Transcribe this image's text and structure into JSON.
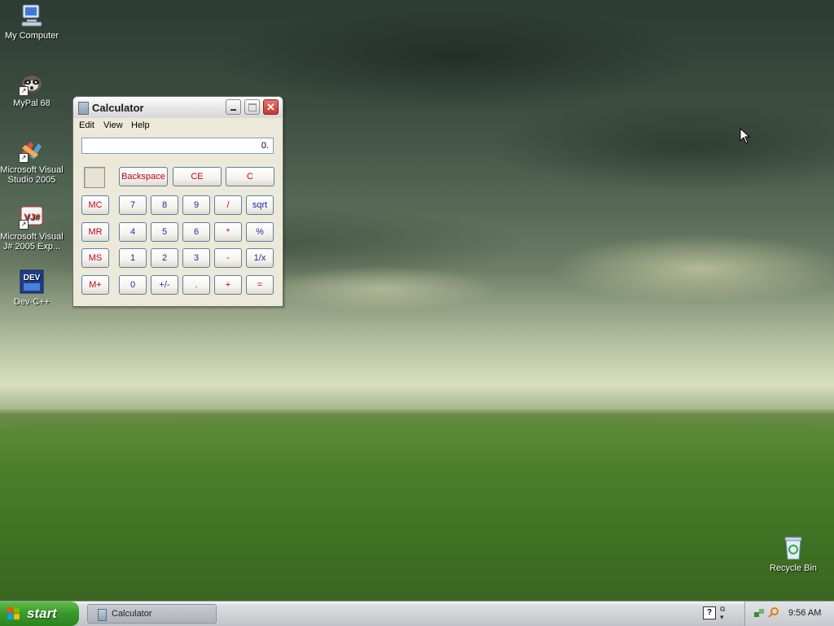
{
  "desktop": {
    "icons": [
      {
        "label": "My Computer"
      },
      {
        "label": "MyPal 68"
      },
      {
        "label": "Microsoft Visual Studio 2005"
      },
      {
        "label": "Microsoft Visual J# 2005 Exp..."
      },
      {
        "label": "Dev-C++"
      },
      {
        "label": "Recycle Bin"
      }
    ]
  },
  "calculator": {
    "title": "Calculator",
    "menu": [
      "Edit",
      "View",
      "Help"
    ],
    "display": "0.",
    "buttons": {
      "backspace": "Backspace",
      "ce": "CE",
      "c": "C",
      "mc": "MC",
      "mr": "MR",
      "ms": "MS",
      "mplus": "M+",
      "d7": "7",
      "d8": "8",
      "d9": "9",
      "div": "/",
      "sqrt": "sqrt",
      "d4": "4",
      "d5": "5",
      "d6": "6",
      "mul": "*",
      "pct": "%",
      "d1": "1",
      "d2": "2",
      "d3": "3",
      "sub": "-",
      "recip": "1/x",
      "d0": "0",
      "sign": "+/-",
      "dot": ".",
      "add": "+",
      "eq": "="
    }
  },
  "taskbar": {
    "start_label": "start",
    "tasks": [
      {
        "label": "Calculator"
      }
    ],
    "clock": "9:56 AM",
    "help_glyph": "?"
  },
  "colors": {
    "start_green": "#3a9b2b",
    "calc_red": "#c0001c",
    "calc_blue": "#1e2f9b"
  }
}
